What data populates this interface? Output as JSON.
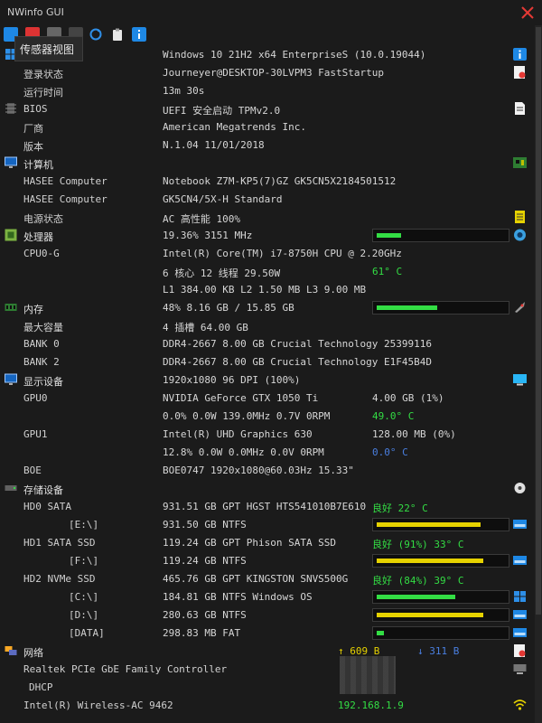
{
  "window": {
    "title": "NWinfo GUI"
  },
  "tooltip": {
    "text": "传感器视图"
  },
  "rows": {
    "os": {
      "value": "Windows 10 21H2 x64 EnterpriseS (10.0.19044)"
    },
    "login": {
      "label": "登录状态",
      "value": "Journeyer@DESKTOP-30LVPM3 FastStartup"
    },
    "uptime": {
      "label": "运行时间",
      "value": "13m 30s"
    },
    "bios": {
      "label": "BIOS",
      "value": "UEFI 安全启动 TPMv2.0"
    },
    "vendor": {
      "label": "厂商",
      "value": "American Megatrends Inc."
    },
    "version": {
      "label": "版本",
      "value": "N.1.04 11/01/2018"
    },
    "computer": {
      "label": "计算机"
    },
    "hasee1": {
      "label": "HASEE Computer",
      "value": "Notebook Z7M-KP5(7)GZ GK5CN5X2184501512"
    },
    "hasee2": {
      "label": "HASEE Computer",
      "value": "GK5CN4/5X-H Standard"
    },
    "power": {
      "label": "电源状态",
      "value": "AC  高性能 100%"
    },
    "cpu": {
      "label": "处理器",
      "value": "19.36% 3151 MHz",
      "usage": 0.19
    },
    "cpu0": {
      "label": "CPU0-G",
      "value": "Intel(R) Core(TM) i7-8750H CPU @ 2.20GHz"
    },
    "cpucores": {
      "value": "6 核心 12 线程 29.50W",
      "temp": "61° C"
    },
    "cache": {
      "value": "L1 384.00 KB L2 1.50 MB L3 9.00 MB"
    },
    "memory": {
      "label": "内存",
      "value": "48% 8.16 GB / 15.85 GB",
      "usage": 0.48
    },
    "maxcap": {
      "label": "最大容量",
      "value": "4 插槽 64.00 GB"
    },
    "bank0": {
      "label": "BANK 0",
      "value": "DDR4-2667 8.00 GB Crucial Technology 25399116"
    },
    "bank2": {
      "label": "BANK 2",
      "value": "DDR4-2667 8.00 GB Crucial Technology E1F45B4D"
    },
    "display": {
      "label": "显示设备",
      "value": "1920x1080 96 DPI (100%)"
    },
    "gpu0": {
      "label": "GPU0",
      "value": "NVIDIA GeForce GTX 1050 Ti",
      "mem": "4.00 GB (1%)"
    },
    "gpu0stat": {
      "value": "0.0% 0.0W 139.0MHz 0.7V 0RPM",
      "temp": "49.0° C"
    },
    "gpu1": {
      "label": "GPU1",
      "value": "Intel(R) UHD Graphics 630",
      "mem": "128.00 MB (0%)"
    },
    "gpu1stat": {
      "value": "12.8% 0.0W 0.0MHz 0.0V 0RPM",
      "temp": "0.0° C"
    },
    "boe": {
      "label": "BOE",
      "value": "BOE0747 1920x1080@60.03Hz 15.33\""
    },
    "storage": {
      "label": "存储设备"
    },
    "hd0": {
      "label": "HD0 SATA",
      "value": "931.51 GB GPT HGST HTS541010B7E610",
      "health": "良好  22° C"
    },
    "volE": {
      "label": "[E:\\]",
      "value": "931.50 GB NTFS",
      "usage": 0.82
    },
    "hd1": {
      "label": "HD1 SATA SSD",
      "value": "119.24 GB GPT Phison SATA SSD",
      "health": "良好 (91%) 33° C"
    },
    "volF": {
      "label": "[F:\\]",
      "value": "119.24 GB NTFS",
      "usage": 0.84
    },
    "hd2": {
      "label": "HD2 NVMe SSD",
      "value": "465.76 GB GPT KINGSTON SNVS500G",
      "health": "良好 (84%) 39° C"
    },
    "volC": {
      "label": "[C:\\]",
      "value": "184.81 GB NTFS Windows  OS",
      "usage": 0.62
    },
    "volD": {
      "label": "[D:\\]",
      "value": "280.63 GB NTFS",
      "usage": 0.84
    },
    "volData": {
      "label": "[DATA]",
      "value": "298.83 MB FAT",
      "usage": 0.06
    },
    "network": {
      "label": "网络",
      "up": "↑ 609 B",
      "down": "↓ 311 B"
    },
    "realtek": {
      "label": "Realtek PCIe GbE Family Controller"
    },
    "dhcp": {
      "label": "DHCP"
    },
    "wifi": {
      "label": "Intel(R) Wireless-AC 9462",
      "value": "192.168.1.9"
    }
  },
  "colors": {
    "green": "#33dd44",
    "yellow": "#e6d200",
    "blue": "#4a7fe0",
    "accent": "#1e88e5",
    "close": "#e53935"
  }
}
